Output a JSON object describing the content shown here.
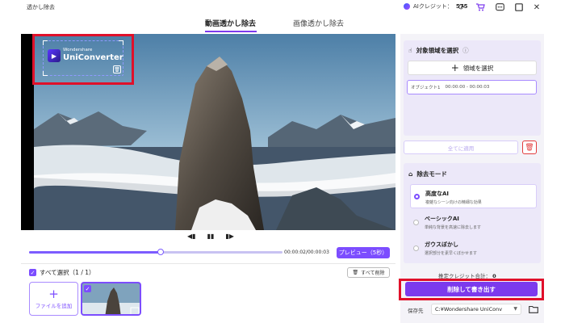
{
  "window": {
    "title": "透かし除去",
    "credit_label": "AIクレジット：",
    "credit_value": "575",
    "icons": [
      "refresh-icon",
      "cart-icon",
      "chat-icon",
      "maximize-icon",
      "close-icon"
    ]
  },
  "tabs": [
    {
      "label": "動画透かし除去",
      "active": true
    },
    {
      "label": "画像透かし除去",
      "active": false
    }
  ],
  "watermark": {
    "small_text": "Wondershare",
    "big_text": "UniConverter"
  },
  "playback": {
    "current": "00:00:02",
    "total": "00:00:03",
    "time_text": "00:00:02/00:00:03",
    "progress": 0.52,
    "preview_label": "プレビュー（5秒）"
  },
  "files": {
    "select_all_label": "すべて選択（1 / 1）",
    "delete_all_label": "すべて削除",
    "add_file_label": "ファイルを追加"
  },
  "region": {
    "title": "対象領域を選択",
    "add_label": "領域を選択",
    "objects": [
      {
        "name": "オブジェクト1",
        "range": "00:00:00 - 00:00:03"
      }
    ],
    "apply_all_label": "全てに適用"
  },
  "mode": {
    "title": "除去モード",
    "options": [
      {
        "title": "高度なAI",
        "desc": "複雑なシーン向けの精細な効果",
        "selected": true
      },
      {
        "title": "ベーシックAI",
        "desc": "単純な背景を高速に除去します",
        "selected": false
      },
      {
        "title": "ガウスぼかし",
        "desc": "選択部分を素早くぼかせます",
        "selected": false
      }
    ]
  },
  "export": {
    "total_credit_label": "推定クレジット合計：",
    "total_credit_value": "0",
    "button_label": "削除して書き出す",
    "save_label": "保存先",
    "save_path": "C:¥Wondershare UniConv"
  },
  "colors": {
    "accent": "#7c3aed",
    "highlight_red": "#e0102a"
  }
}
